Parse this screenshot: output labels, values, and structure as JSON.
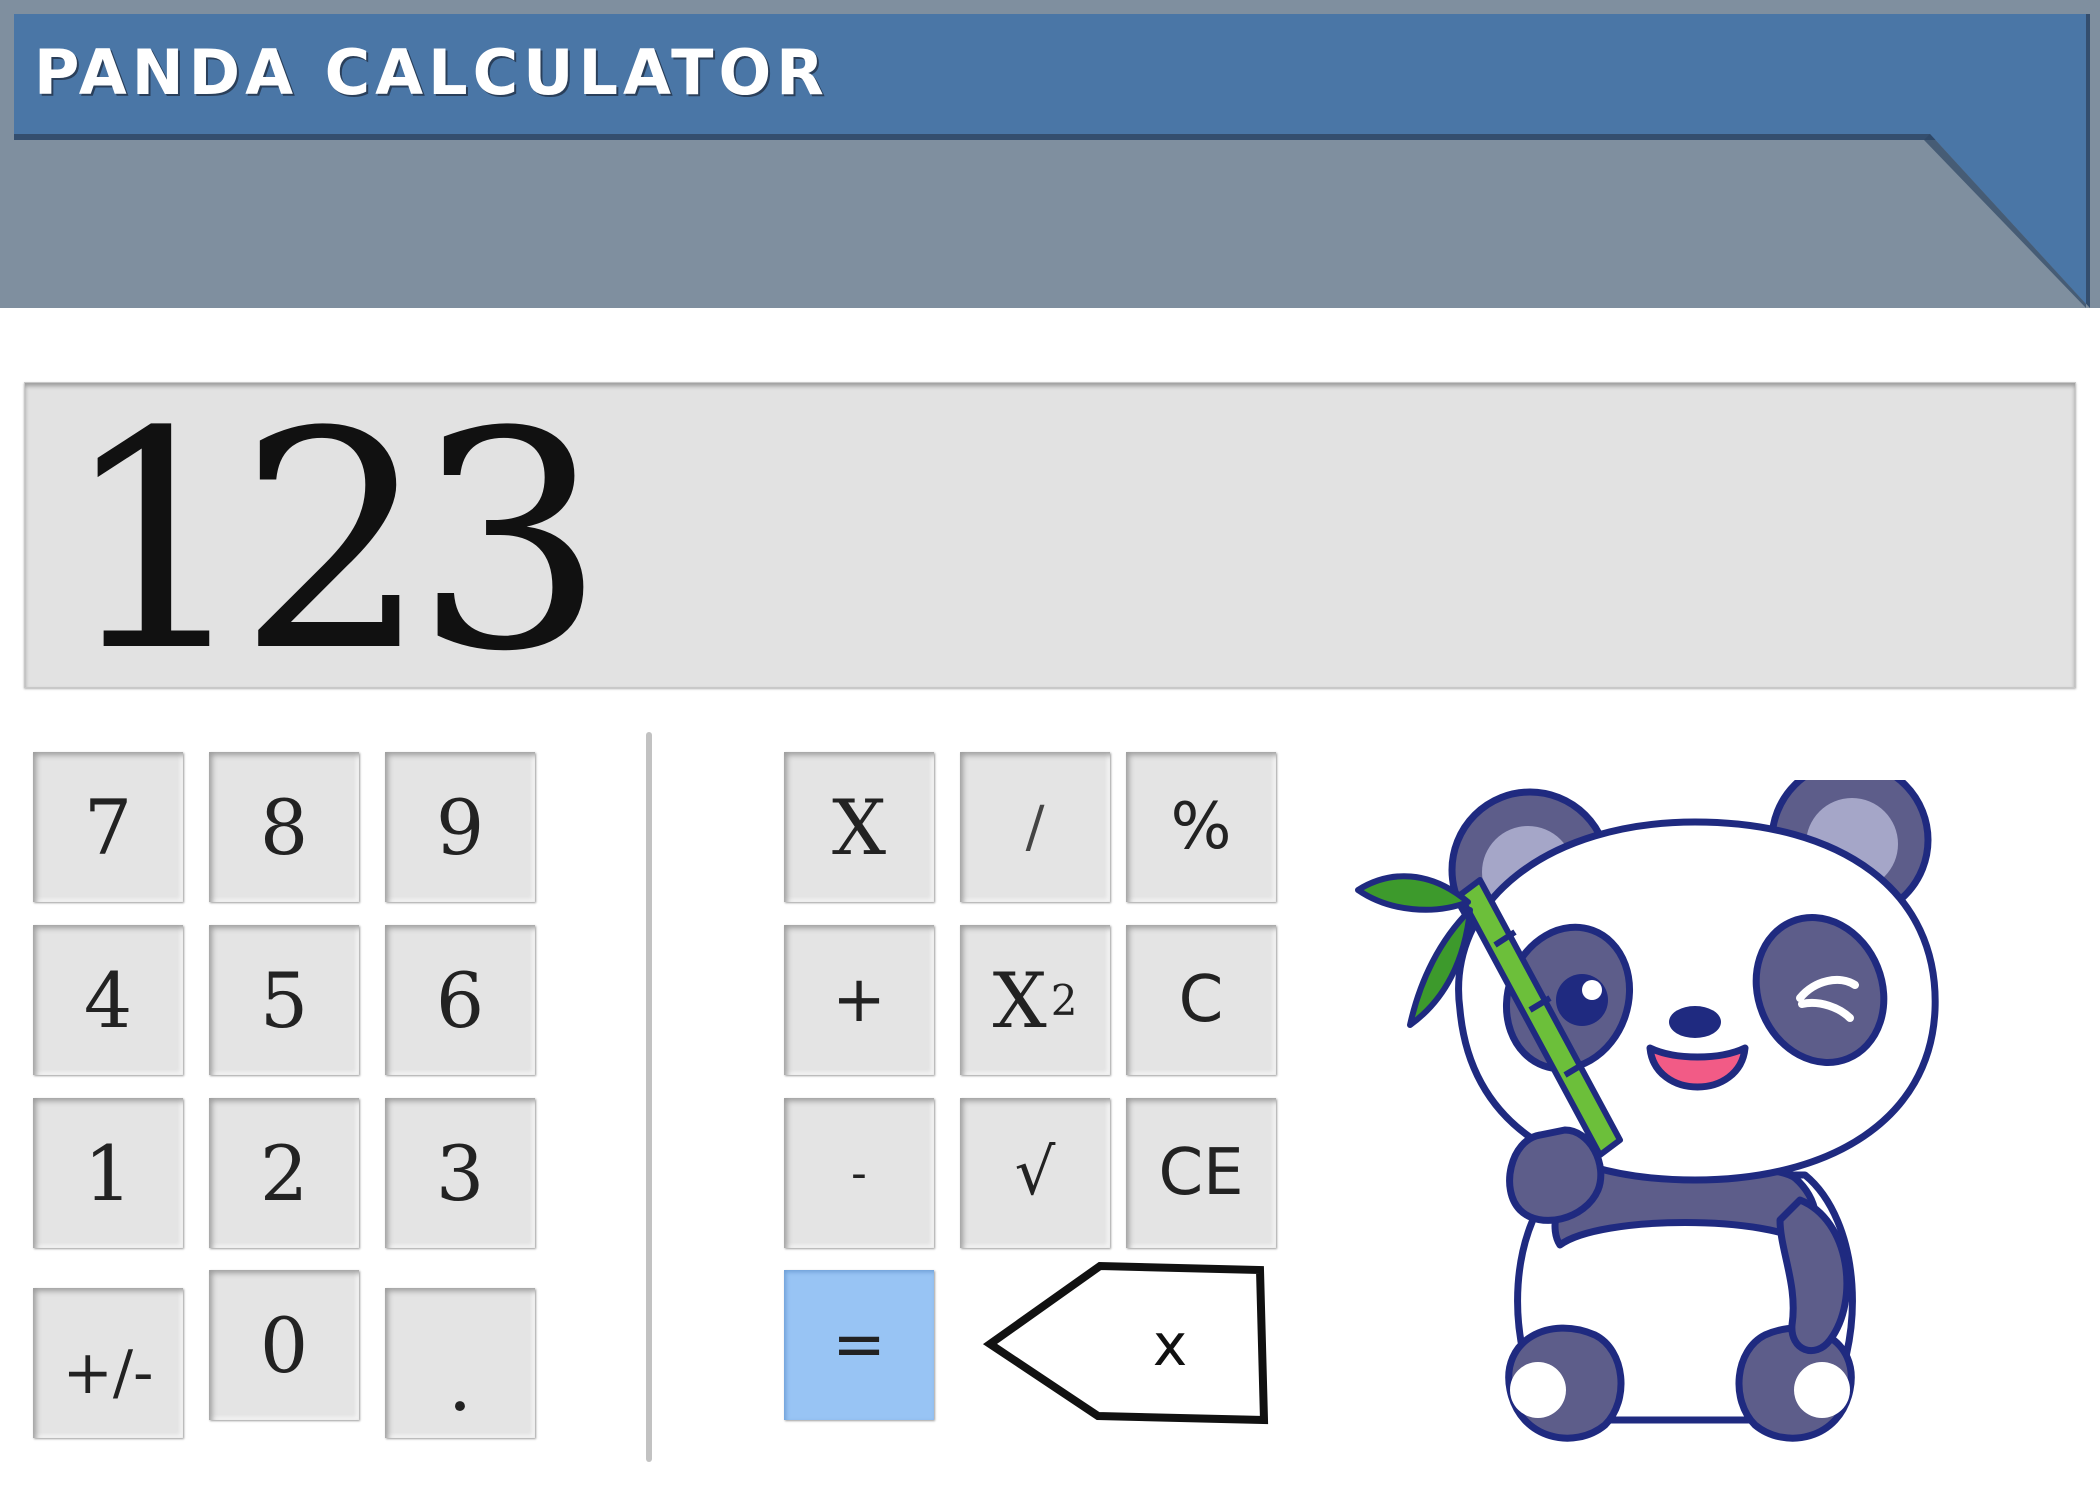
{
  "app": {
    "title": "PANDA CALCULATOR"
  },
  "display": {
    "value": "123"
  },
  "numpad": {
    "keys": [
      {
        "label": "7"
      },
      {
        "label": "8"
      },
      {
        "label": "9"
      },
      {
        "label": "4"
      },
      {
        "label": "5"
      },
      {
        "label": "6"
      },
      {
        "label": "1"
      },
      {
        "label": "2"
      },
      {
        "label": "3"
      },
      {
        "label": "+/-"
      },
      {
        "label": "0"
      },
      {
        "label": "."
      }
    ]
  },
  "operators": {
    "multiply": "X",
    "divide": "/",
    "percent": "%",
    "add": "+",
    "square_base": "X",
    "square_exp": "2",
    "clear": "C",
    "subtract": "-",
    "sqrt": "√",
    "clear_entry": "CE",
    "equals": "=",
    "backspace": "x"
  },
  "colors": {
    "header_bar": "#4a76a6",
    "header_bg": "#7f8f9f",
    "display_bg": "#e2e2e2",
    "key_bg": "#e4e4e4",
    "equals_bg": "#98c4f4"
  },
  "icons": {
    "mascot": "panda-with-bamboo-icon",
    "backspace": "backspace-arrow-icon"
  }
}
